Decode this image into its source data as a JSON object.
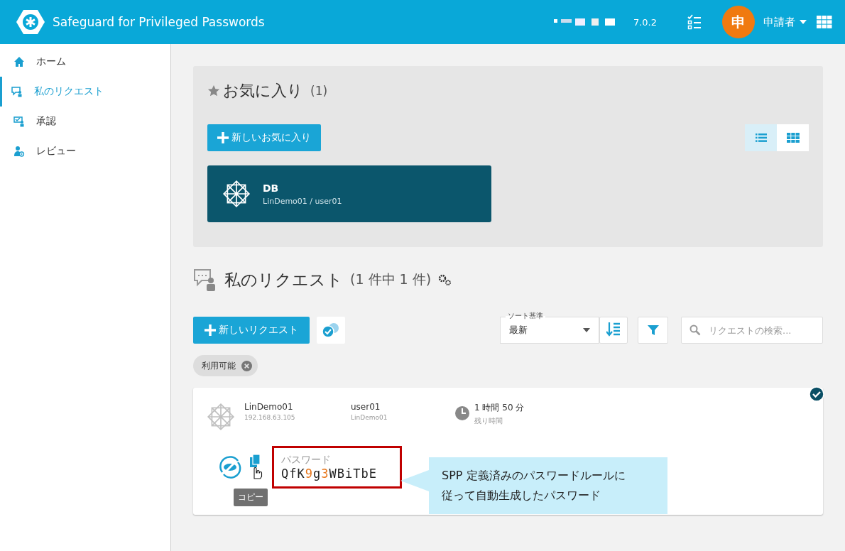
{
  "header": {
    "title": "Safeguard for Privileged Passwords",
    "version": "7.0.2",
    "avatar": "申",
    "user": "申請者"
  },
  "sidebar": {
    "items": [
      {
        "label": "ホーム",
        "kind": "home",
        "selected": false
      },
      {
        "label": "私のリクエスト",
        "kind": "request",
        "selected": true
      },
      {
        "label": "承認",
        "kind": "approve",
        "selected": false
      },
      {
        "label": "レビュー",
        "kind": "review",
        "selected": false
      }
    ]
  },
  "favorites": {
    "title": "お気に入り",
    "count": "(1)",
    "new_button": "新しいお気に入り",
    "views": [
      {
        "kind": "list",
        "selected": true
      },
      {
        "kind": "grid",
        "selected": false
      }
    ],
    "items": [
      {
        "name": "DB",
        "detail": "LinDemo01 / user01"
      }
    ]
  },
  "requests": {
    "title": "私のリクエスト",
    "count": "(1 件中 1 件)",
    "new_button": "新しいリクエスト",
    "sort": {
      "label": "ソート基準",
      "value": "最新"
    },
    "search": {
      "placeholder": "リクエストの検索..."
    },
    "filters": [
      {
        "label": "利用可能"
      }
    ],
    "items": [
      {
        "asset": "LinDemo01",
        "address": "192.168.63.105",
        "account": "user01",
        "account_asset": "LinDemo01",
        "time": "1 時間 50 分",
        "time_label": "残り時間",
        "checked": true,
        "password_label": "パスワード",
        "password": "QfK9g3WBiTbE",
        "tooltip": "コピー"
      }
    ]
  },
  "callout": "SPP 定義済みのパスワードルールに従って自動生成したパスワード"
}
